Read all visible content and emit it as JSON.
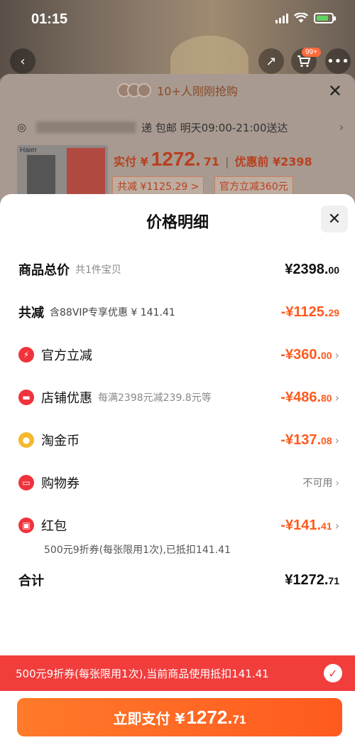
{
  "status_bar": {
    "time": "01:15"
  },
  "background": {
    "cart_badge": "99+",
    "banner_text": "10+人刚刚抢购",
    "address_suffix": "递 包邮 明天09:00-21:00送达",
    "brand": "Haier",
    "price_label": "实付 ¥",
    "price_main": "1272.",
    "price_dec": "71",
    "price_before": "优惠前 ¥2398",
    "tag_discount": "共减 ¥1125.29 >",
    "tag_official": "官方立减360元"
  },
  "modal": {
    "title": "价格明细",
    "rows": [
      {
        "label": "商品总价",
        "sub": "共1件宝贝",
        "main": "¥2398.",
        "dec": "00"
      },
      {
        "label": "共减",
        "sub": "含88VIP专享优惠 ¥ 141.41",
        "main": "-¥1125.",
        "dec": "29"
      },
      {
        "label": "官方立减",
        "main": "-¥360.",
        "dec": "00"
      },
      {
        "label": "店铺优惠",
        "sub": "每满2398元减239.8元等",
        "main": "-¥486.",
        "dec": "80"
      },
      {
        "label": "淘金币",
        "main": "-¥137.",
        "dec": "08"
      },
      {
        "label": "购物券",
        "value": "不可用"
      },
      {
        "label": "红包",
        "main": "-¥141.",
        "dec": "41"
      },
      {
        "label": "合计",
        "main": "¥1272.",
        "dec": "71"
      }
    ],
    "redpacket_note": "500元9折券(每张限用1次),已抵扣141.41"
  },
  "promo_bar": {
    "text": "500元9折券(每张限用1次),当前商品使用抵扣141.41"
  },
  "pay_button": {
    "label": "立即支付 ¥",
    "main": "1272.",
    "dec": "71"
  },
  "colors": {
    "accent_orange": "#ff5a1f",
    "promo_red": "#f23d3d",
    "icon_red": "#f0323c",
    "coin_gold": "#f5b82e"
  }
}
